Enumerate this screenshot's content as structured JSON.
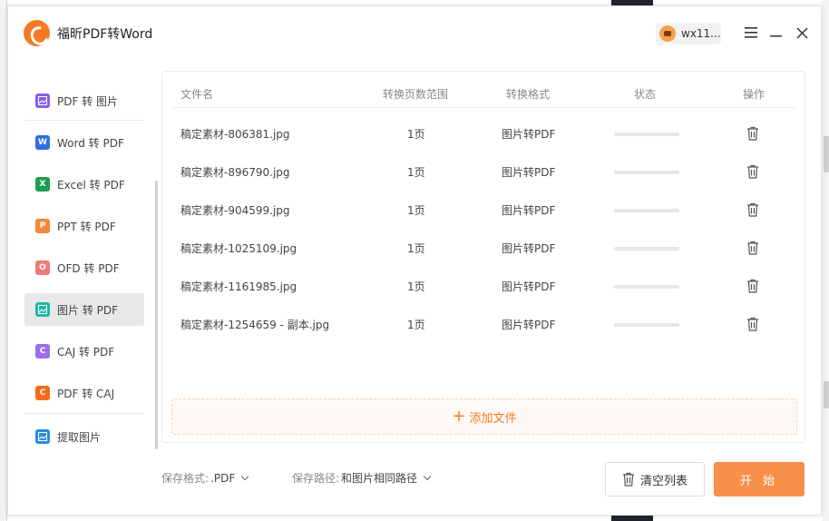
{
  "app": {
    "title": "福昕PDF转Word",
    "user_name": "wx11...",
    "accent": "#f57a22"
  },
  "sidebar": {
    "items": [
      {
        "label": "PDF 转 图片",
        "icon": "image-icon",
        "color": "#8a5cf0",
        "glyph": ""
      },
      {
        "label": "Word 转 PDF",
        "icon": "word-icon",
        "color": "#2f6fe0",
        "glyph": "W"
      },
      {
        "label": "Excel 转 PDF",
        "icon": "excel-icon",
        "color": "#1e9e52",
        "glyph": "X"
      },
      {
        "label": "PPT 转 PDF",
        "icon": "ppt-icon",
        "color": "#f0893a",
        "glyph": "P"
      },
      {
        "label": "OFD 转 PDF",
        "icon": "ofd-icon",
        "color": "#f07a7a",
        "glyph": "O"
      },
      {
        "label": "图片 转 PDF",
        "icon": "image-to-pdf-icon",
        "color": "#1fb7a6",
        "glyph": "",
        "active": true
      },
      {
        "label": "CAJ 转 PDF",
        "icon": "caj-icon",
        "color": "#9a6ff0",
        "glyph": "C"
      },
      {
        "label": "PDF 转 CAJ",
        "icon": "pdf-to-caj-icon",
        "color": "#f26b1d",
        "glyph": "C"
      },
      {
        "label": "提取图片",
        "icon": "extract-image-icon",
        "color": "#2a8be0",
        "glyph": ""
      }
    ]
  },
  "table": {
    "headers": [
      "文件名",
      "转换页数范围",
      "转换格式",
      "状态",
      "操作"
    ],
    "rows": [
      {
        "name": "稿定素材-806381.jpg",
        "pages": "1页",
        "format": "图片转PDF",
        "progress": 0
      },
      {
        "name": "稿定素材-896790.jpg",
        "pages": "1页",
        "format": "图片转PDF",
        "progress": 0
      },
      {
        "name": "稿定素材-904599.jpg",
        "pages": "1页",
        "format": "图片转PDF",
        "progress": 0
      },
      {
        "name": "稿定素材-1025109.jpg",
        "pages": "1页",
        "format": "图片转PDF",
        "progress": 0
      },
      {
        "name": "稿定素材-1161985.jpg",
        "pages": "1页",
        "format": "图片转PDF",
        "progress": 0
      },
      {
        "name": "稿定素材-1254659 - 副本.jpg",
        "pages": "1页",
        "format": "图片转PDF",
        "progress": 0
      }
    ],
    "add_files_label": "添加文件"
  },
  "footer": {
    "save_format_label": "保存格式:",
    "save_format_value": ".PDF",
    "save_path_label": "保存路径:",
    "save_path_value": "和图片相同路径",
    "clear_button": "清空列表",
    "start_button": "开 始"
  }
}
